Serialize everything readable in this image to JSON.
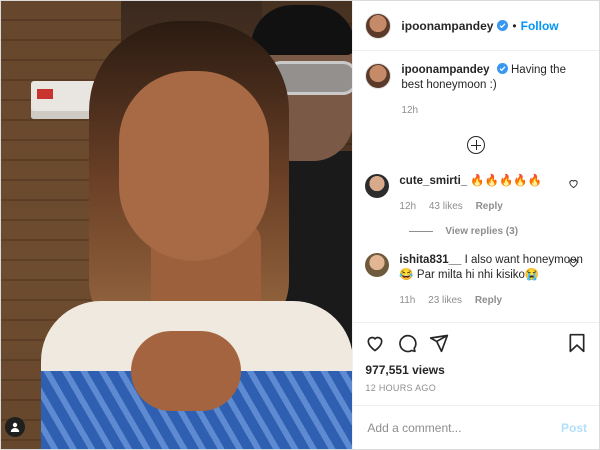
{
  "header": {
    "username": "ipoonampandey",
    "dot": "•",
    "follow_label": "Follow"
  },
  "caption": {
    "username": "ipoonampandey",
    "text": "Having the best honeymoon :)",
    "age": "12h"
  },
  "comments": [
    {
      "username": "cute_smirti_",
      "text": "🔥🔥🔥🔥🔥",
      "age": "12h",
      "likes": "43 likes",
      "reply_label": "Reply",
      "view_replies": "View replies (3)"
    },
    {
      "username": "ishita831__",
      "text": "I also want honeymoon😂 Par milta hi nhi kisiko😭",
      "age": "11h",
      "likes": "23 likes",
      "reply_label": "Reply"
    }
  ],
  "stats": {
    "views": "977,551 views",
    "timestamp": "12 HOURS AGO"
  },
  "add_comment": {
    "placeholder": "Add a comment...",
    "post_label": "Post"
  },
  "colors": {
    "link_blue": "#0095f6",
    "post_disabled": "#b2dffc",
    "muted": "#8e8e8e"
  },
  "icons": [
    "verified-icon",
    "load-more-plus-icon",
    "heart-icon",
    "comment-icon",
    "share-icon",
    "save-icon",
    "user-tag-icon"
  ]
}
